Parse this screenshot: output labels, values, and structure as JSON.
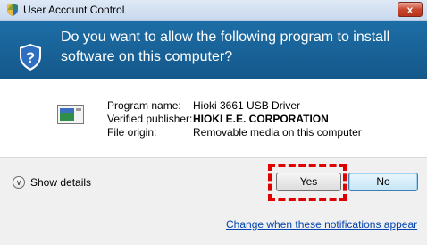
{
  "window": {
    "title": "User Account Control",
    "close_label": "x"
  },
  "header": {
    "question": "Do you want to allow the following program to install software on this computer?"
  },
  "program": {
    "name_label": "Program name:",
    "name_value": "Hioki 3661 USB Driver",
    "publisher_label": "Verified publisher:",
    "publisher_value": "HIOKI E.E. CORPORATION",
    "origin_label": "File origin:",
    "origin_value": "Removable media on this computer"
  },
  "footer": {
    "show_details_label": "Show details",
    "yes_label": "Yes",
    "no_label": "No",
    "notifications_link": "Change when these notifications appear"
  },
  "icons": {
    "title": "uac-shield-icon",
    "header": "shield-question-icon",
    "program": "program-icon",
    "details": "chevron-down-icon"
  },
  "colors": {
    "header_bg": "#1a659c",
    "highlight": "#e00000",
    "link": "#0645ad"
  }
}
